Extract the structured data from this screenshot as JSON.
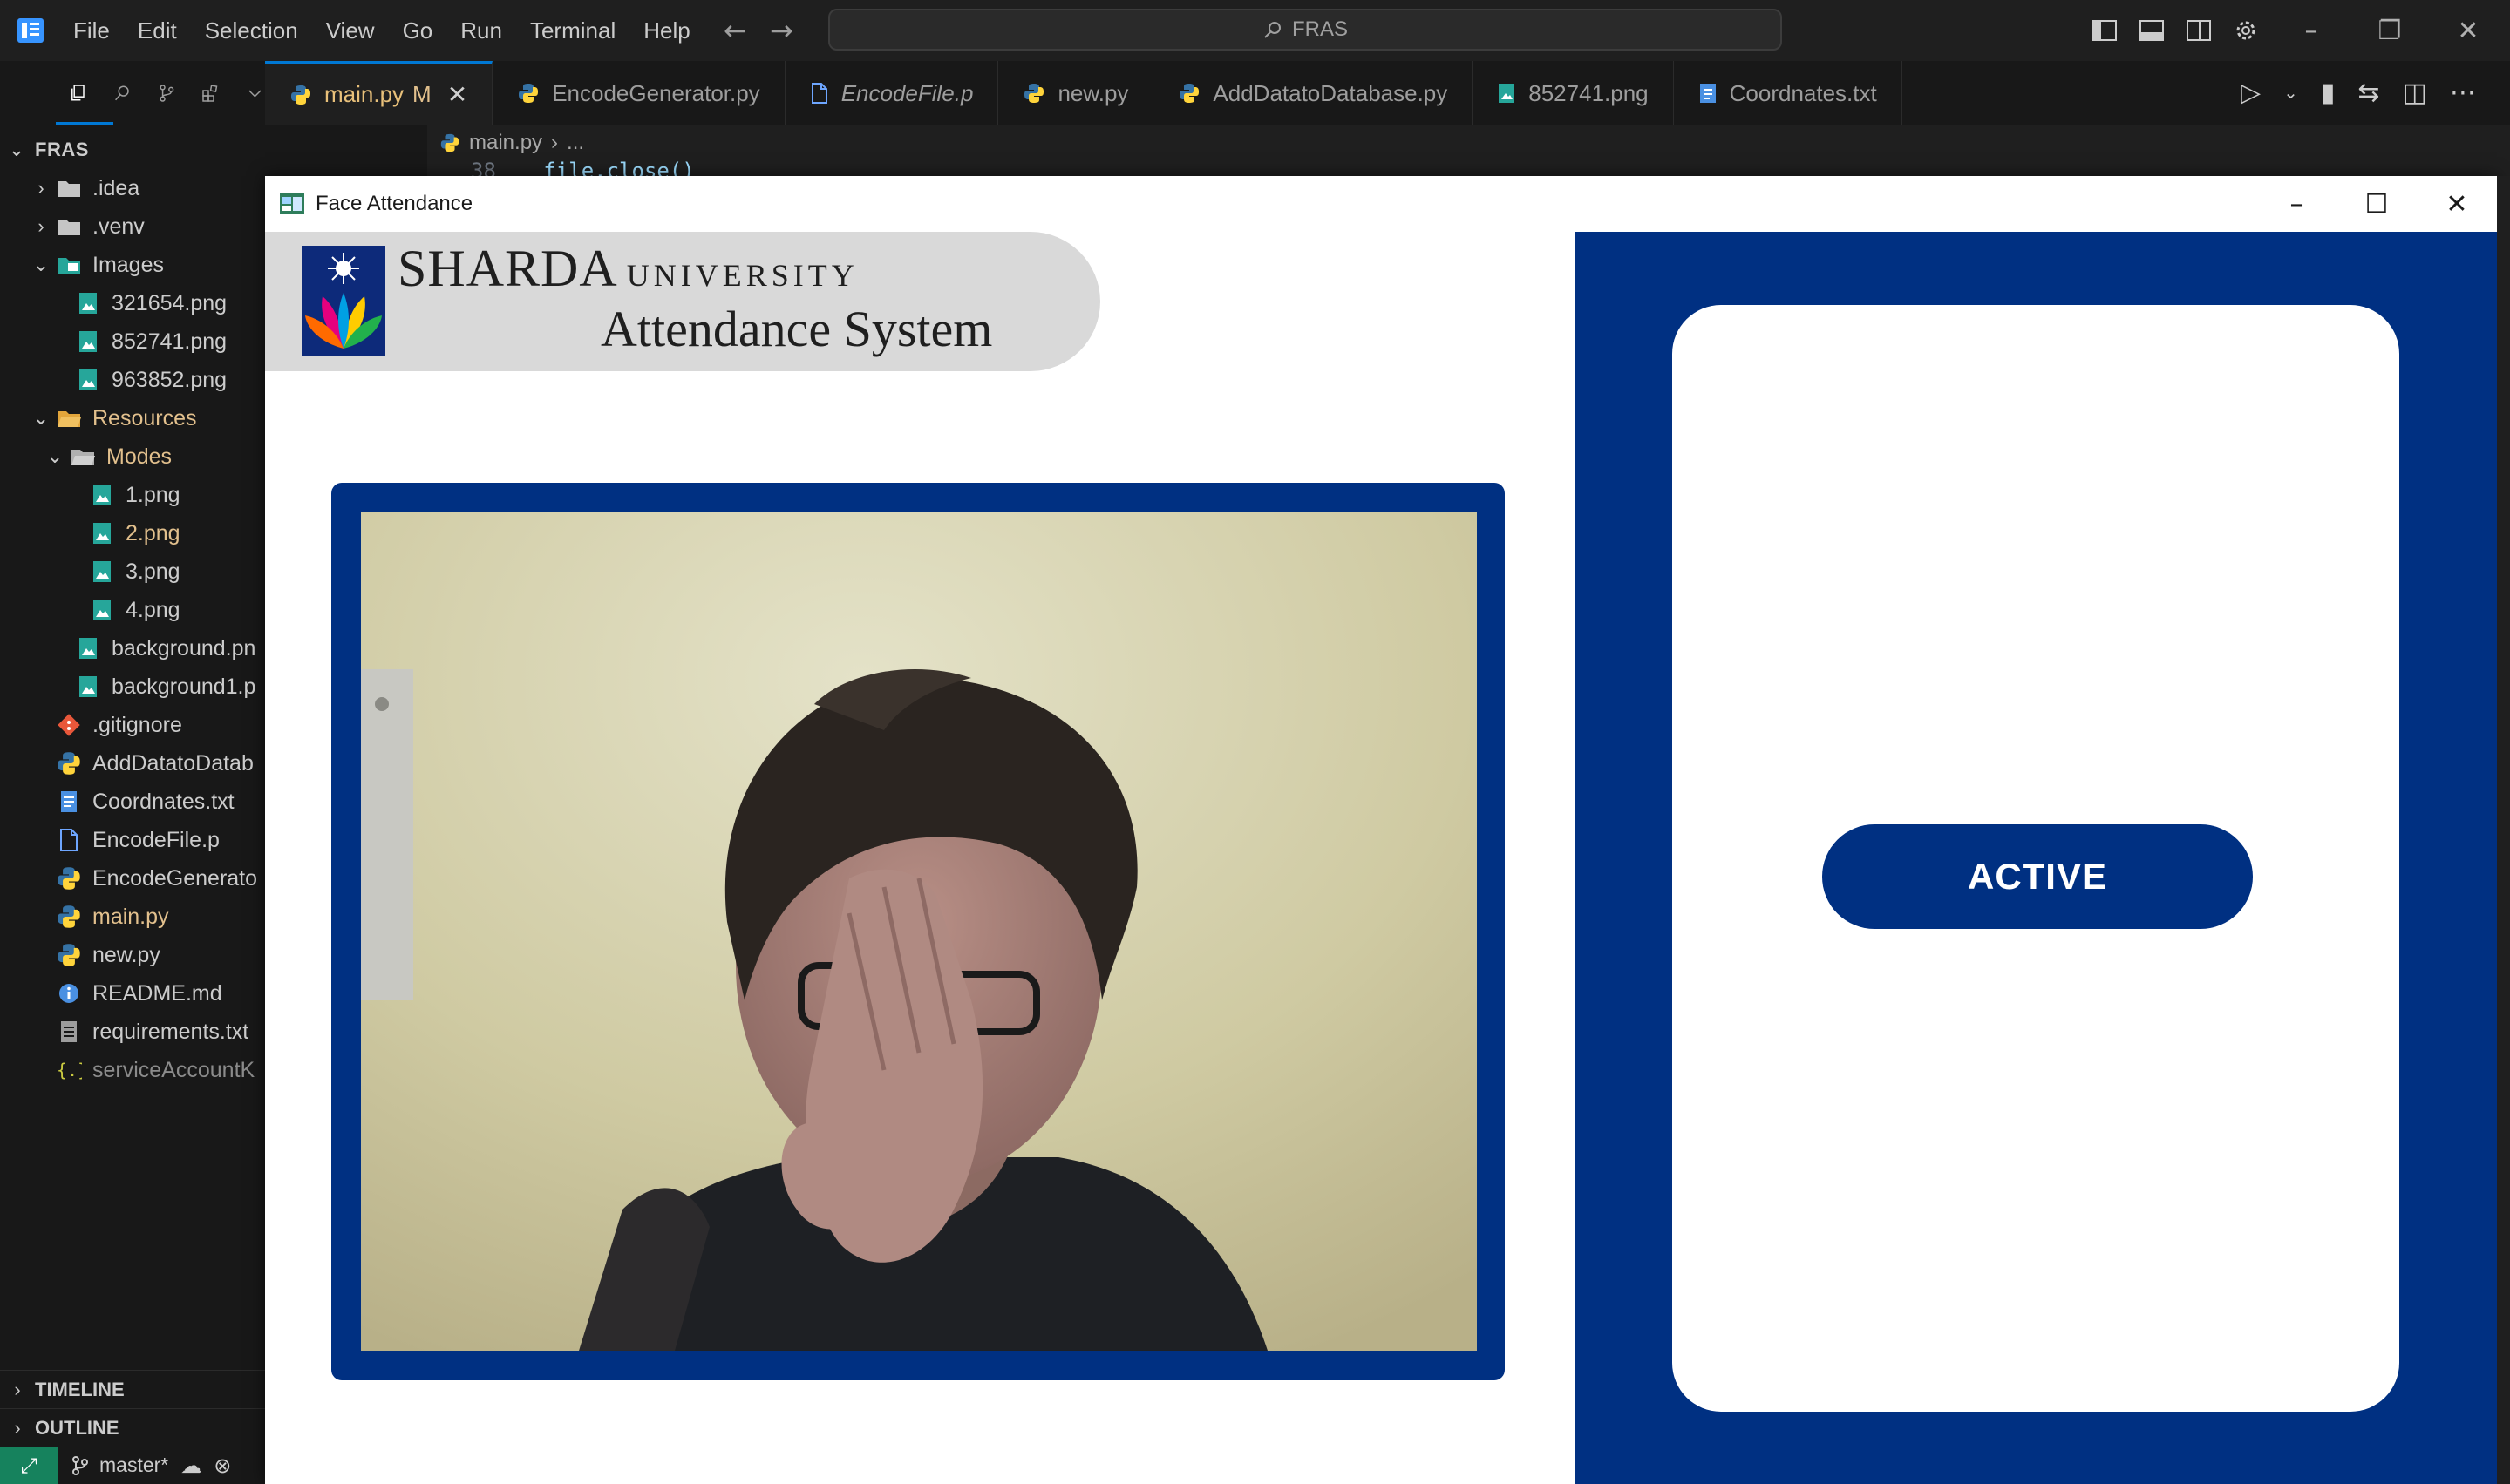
{
  "vscode": {
    "menu": [
      "File",
      "Edit",
      "Selection",
      "View",
      "Go",
      "Run",
      "Terminal",
      "Help"
    ],
    "search": {
      "value": "FRAS"
    },
    "tabs": [
      {
        "label": "main.py",
        "badge": "M",
        "active": true,
        "icon": "python-icon"
      },
      {
        "label": "EncodeGenerator.py",
        "icon": "python-icon"
      },
      {
        "label": "EncodeFile.p",
        "italic": true,
        "icon": "file-icon"
      },
      {
        "label": "new.py",
        "icon": "python-icon"
      },
      {
        "label": "AddDatatoDatabase.py",
        "icon": "python-icon"
      },
      {
        "label": "852741.png",
        "icon": "image-icon"
      },
      {
        "label": "Coordnates.txt",
        "icon": "text-file-icon"
      }
    ],
    "breadcrumb": {
      "file": "main.py",
      "rest": "..."
    },
    "code": {
      "line_number": "38",
      "text": "file.close()"
    },
    "explorer": {
      "root": "FRAS",
      "items": [
        {
          "label": ".idea",
          "icon": "folder-icon"
        },
        {
          "label": ".venv",
          "icon": "folder-icon"
        },
        {
          "label": "Images",
          "icon": "image-folder-icon"
        },
        {
          "label": "321654.png",
          "icon": "image-icon"
        },
        {
          "label": "852741.png",
          "icon": "image-icon"
        },
        {
          "label": "963852.png",
          "icon": "image-icon"
        },
        {
          "label": "Resources",
          "icon": "open-folder-icon",
          "modified": true
        },
        {
          "label": "Modes",
          "icon": "open-folder-icon",
          "modified": true
        },
        {
          "label": "1.png",
          "icon": "image-icon"
        },
        {
          "label": "2.png",
          "icon": "image-icon",
          "modified": true
        },
        {
          "label": "3.png",
          "icon": "image-icon"
        },
        {
          "label": "4.png",
          "icon": "image-icon"
        },
        {
          "label": "background.pn",
          "icon": "image-icon"
        },
        {
          "label": "background1.p",
          "icon": "image-icon"
        },
        {
          "label": ".gitignore",
          "icon": "git-icon"
        },
        {
          "label": "AddDatatoDatab",
          "icon": "python-icon"
        },
        {
          "label": "Coordnates.txt",
          "icon": "text-file-icon"
        },
        {
          "label": "EncodeFile.p",
          "icon": "file-icon"
        },
        {
          "label": "EncodeGenerato",
          "icon": "python-icon"
        },
        {
          "label": "main.py",
          "icon": "python-icon",
          "modified": true
        },
        {
          "label": "new.py",
          "icon": "python-icon"
        },
        {
          "label": "README.md",
          "icon": "info-icon"
        },
        {
          "label": "requirements.txt",
          "icon": "list-file-icon"
        },
        {
          "label": "serviceAccountK",
          "icon": "json-icon",
          "dimmed": true
        }
      ],
      "sections": [
        "TIMELINE",
        "OUTLINE"
      ]
    },
    "statusbar": {
      "branch": "master*"
    }
  },
  "face_attendance": {
    "window_title": "Face Attendance",
    "logo": {
      "name": "SHARDA",
      "suffix": "UNIVERSITY",
      "subtitle": "Attendance System"
    },
    "status": "ACTIVE"
  },
  "colors": {
    "university_blue": "#003082",
    "vscode_bg": "#181818",
    "editor_bg": "#1f1f1f",
    "modified_text": "#e2c08d",
    "accent_blue": "#0078d4",
    "remote_green": "#16825d"
  }
}
